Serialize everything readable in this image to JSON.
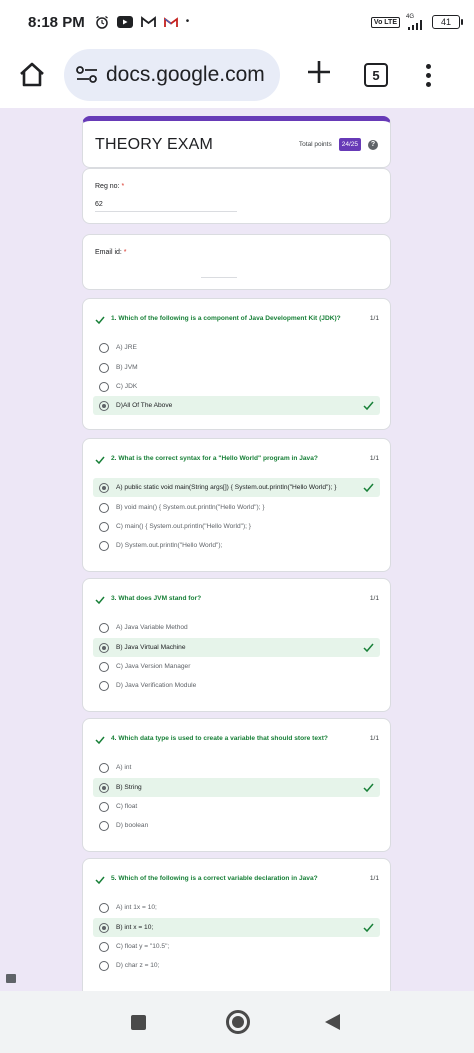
{
  "status_bar": {
    "time": "8:18 PM",
    "network_label": "4G",
    "volte_label": "Vo LTE",
    "battery": "41"
  },
  "browser": {
    "url": "docs.google.com",
    "tab_count": "5"
  },
  "form": {
    "title": "THEORY EXAM",
    "total_points_label": "Total points",
    "total_points_value": "24/25",
    "reg_label": "Reg no:",
    "reg_value": "62",
    "email_label": "Email id:",
    "required_mark": "*"
  },
  "questions": [
    {
      "text": "1. Which of the following is a component of Java Development Kit (JDK)?",
      "score": "1/1",
      "options": [
        "A) JRE",
        "B) JVM",
        "C) JDK",
        "D)All Of The Above"
      ]
    },
    {
      "text": "2. What is the correct syntax for a \"Hello World\" program in Java?",
      "score": "1/1",
      "options": [
        "A) public static void main(String args[]) { System.out.println(\"Hello World\"); }",
        "B) void main() { System.out.println(\"Hello World\"); }",
        "C) main() { System.out.println(\"Hello World\"); }",
        "D) System.out.println(\"Hello World\");"
      ]
    },
    {
      "text": "3. What does JVM stand for?",
      "score": "1/1",
      "options": [
        "A) Java Variable Method",
        "B) Java Virtual Machine",
        "C) Java Version Manager",
        "D) Java Verification Module"
      ]
    },
    {
      "text": "4. Which data type is used to create a variable that should store text?",
      "score": "1/1",
      "options": [
        "A) int",
        "B) String",
        "C) float",
        "D) boolean"
      ]
    },
    {
      "text": "5. Which of the following is a correct variable declaration in Java?",
      "score": "1/1",
      "options": [
        "A) int 1x = 10;",
        "B) int x = 10;",
        "C) float y = \"10.5\";",
        "D) char z = 10;"
      ]
    }
  ],
  "colors": {
    "accent": "#673ab7",
    "correct": "#188038",
    "correct_bg": "#e6f4ea",
    "page_bg": "#ede7f6"
  }
}
